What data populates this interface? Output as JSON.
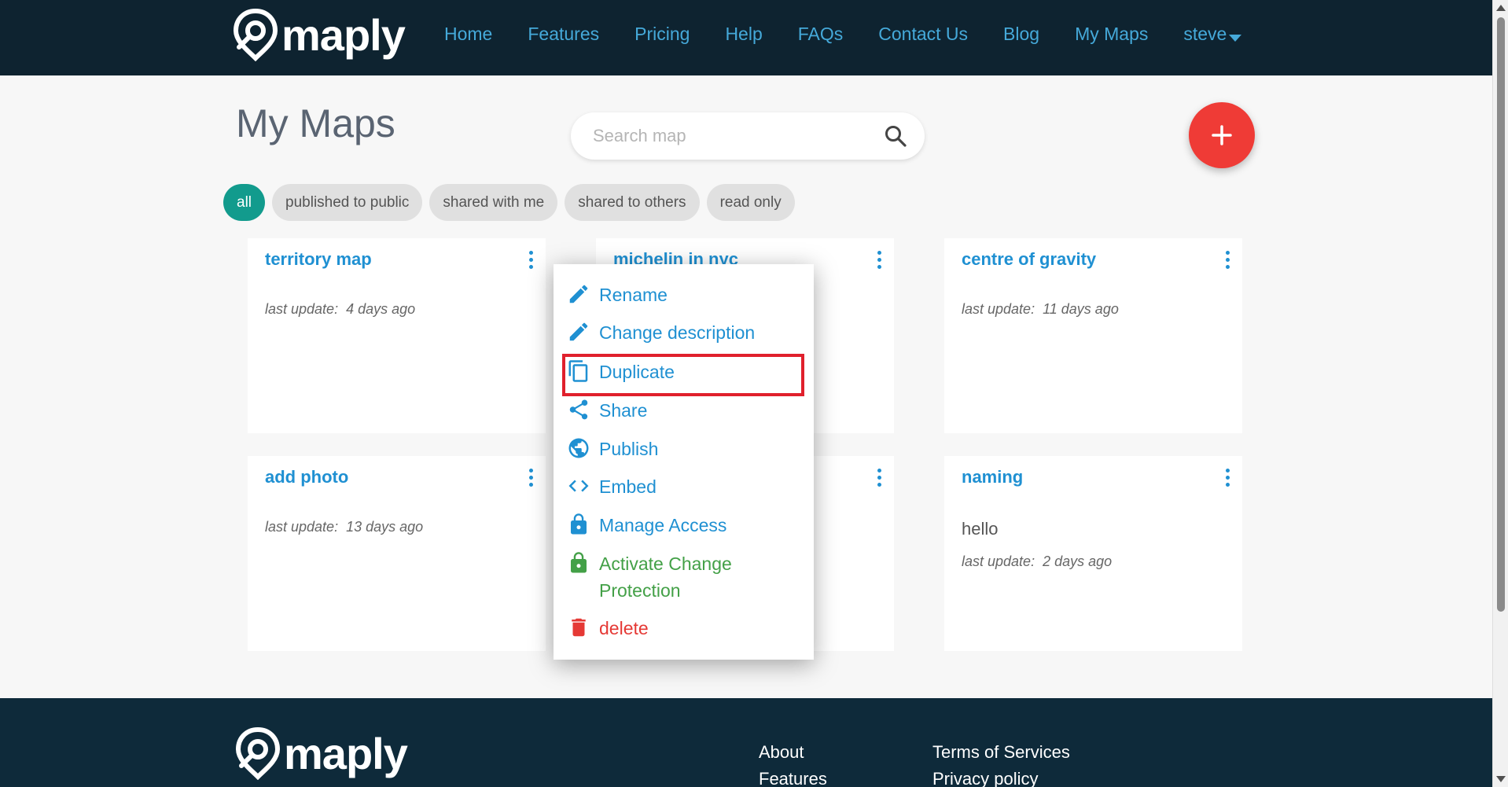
{
  "app": {
    "brand": "maply",
    "colors": {
      "navbar": "#0e2330",
      "link": "#45a9d9",
      "accent": "#1f90d2",
      "add": "#ef3b36",
      "green": "#43a047",
      "red": "#e53935",
      "chip_active": "#129b8d"
    }
  },
  "nav": {
    "items": [
      {
        "label": "Home"
      },
      {
        "label": "Features"
      },
      {
        "label": "Pricing"
      },
      {
        "label": "Help"
      },
      {
        "label": "FAQs"
      },
      {
        "label": "Contact Us"
      },
      {
        "label": "Blog"
      },
      {
        "label": "My Maps"
      },
      {
        "label": "steve"
      }
    ],
    "user_menu_icon": "caret-down-icon"
  },
  "page": {
    "title": "My Maps",
    "search": {
      "placeholder": "Search map",
      "value": "",
      "icon": "search-icon"
    },
    "add_icon": "plus-icon"
  },
  "filters": [
    {
      "label": "all",
      "active": true
    },
    {
      "label": "published to public"
    },
    {
      "label": "shared with me"
    },
    {
      "label": "shared to others"
    },
    {
      "label": "read only"
    }
  ],
  "cards": [
    {
      "title": "territory map",
      "description": "",
      "update_label": "last update:",
      "update_value": "4 days ago"
    },
    {
      "title": "michelin in nyc",
      "description": "",
      "update_label": "",
      "update_value": ""
    },
    {
      "title": "centre of gravity",
      "description": "",
      "update_label": "last update:",
      "update_value": "11 days ago"
    },
    {
      "title": "add photo",
      "description": "",
      "update_label": "last update:",
      "update_value": "13 days ago"
    },
    {
      "title": "",
      "description": "",
      "update_label": "",
      "update_value": ""
    },
    {
      "title": "naming",
      "description": "hello",
      "update_label": "last update:",
      "update_value": "2 days ago"
    }
  ],
  "context_menu": {
    "items": [
      {
        "label": "Rename",
        "icon": "pencil-icon"
      },
      {
        "label": "Change description",
        "icon": "pencil-icon"
      },
      {
        "label": "Duplicate",
        "icon": "duplicate-icon",
        "highlighted": true
      },
      {
        "label": "Share",
        "icon": "share-icon"
      },
      {
        "label": "Publish",
        "icon": "globe-icon"
      },
      {
        "label": "Embed",
        "icon": "code-icon"
      },
      {
        "label": "Manage Access",
        "icon": "lock-icon"
      },
      {
        "label": "Activate Change Protection",
        "icon": "lock-icon"
      },
      {
        "label": "delete",
        "icon": "trash-icon"
      }
    ]
  },
  "footer": {
    "brand": "maply",
    "col1": [
      {
        "label": "About"
      },
      {
        "label": "Features"
      }
    ],
    "col2": [
      {
        "label": "Terms of Services"
      },
      {
        "label": "Privacy policy"
      }
    ]
  }
}
